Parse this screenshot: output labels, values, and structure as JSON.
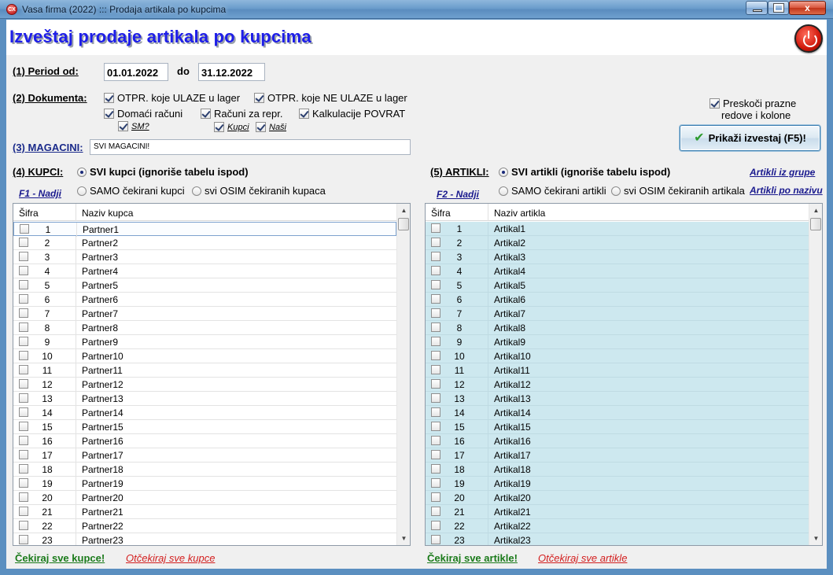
{
  "window": {
    "icon_text": "CX",
    "title": "Vasa firma (2022) ::: Prodaja artikala po kupcima",
    "minimize": "_",
    "maximize": "",
    "close": "x"
  },
  "header": {
    "title": "Izveštaj prodaje artikala po kupcima"
  },
  "period": {
    "label": "(1)  Period od:",
    "from": "01.01.2022",
    "to_label": "do",
    "to": "31.12.2022"
  },
  "documents": {
    "label": "(2)  Dokumenta:",
    "otpr_ulaze": "OTPR. koje ULAZE u lager",
    "otpr_ne_ulaze": "OTPR. koje NE ULAZE u lager",
    "domaci": "Domaći računi",
    "racuni_repr": "Računi za repr.",
    "kalkulacije": "Kalkulacije POVRAT",
    "sm": "SM?",
    "kupci": "Kupci",
    "nasi": "Naši"
  },
  "skip_empty": {
    "line1": "Preskoči prazne",
    "line2": "redove i kolone"
  },
  "show_button": {
    "icon": "✔",
    "label": "Prikaži izvestaj (F5)!"
  },
  "warehouses": {
    "label": "(3)  MAGACINI:",
    "value": "SVI MAGACINI!"
  },
  "customers": {
    "label": "(4)  KUPCI:",
    "all": "SVI kupci (ignoriše tabelu ispod)",
    "only_checked": "SAMO čekirani kupci",
    "except_checked": "svi OSIM čekiranih kupaca",
    "find_link": "F1 - Nadji",
    "col_code": "Šifra",
    "col_name": "Naziv kupca",
    "check_all": "Čekiraj sve kupce!",
    "uncheck_all": "Otčekiraj sve kupce",
    "rows": [
      {
        "code": "1",
        "name": "Partner1"
      },
      {
        "code": "2",
        "name": "Partner2"
      },
      {
        "code": "3",
        "name": "Partner3"
      },
      {
        "code": "4",
        "name": "Partner4"
      },
      {
        "code": "5",
        "name": "Partner5"
      },
      {
        "code": "6",
        "name": "Partner6"
      },
      {
        "code": "7",
        "name": "Partner7"
      },
      {
        "code": "8",
        "name": "Partner8"
      },
      {
        "code": "9",
        "name": "Partner9"
      },
      {
        "code": "10",
        "name": "Partner10"
      },
      {
        "code": "11",
        "name": "Partner11"
      },
      {
        "code": "12",
        "name": "Partner12"
      },
      {
        "code": "13",
        "name": "Partner13"
      },
      {
        "code": "14",
        "name": "Partner14"
      },
      {
        "code": "15",
        "name": "Partner15"
      },
      {
        "code": "16",
        "name": "Partner16"
      },
      {
        "code": "17",
        "name": "Partner17"
      },
      {
        "code": "18",
        "name": "Partner18"
      },
      {
        "code": "19",
        "name": "Partner19"
      },
      {
        "code": "20",
        "name": "Partner20"
      },
      {
        "code": "21",
        "name": "Partner21"
      },
      {
        "code": "22",
        "name": "Partner22"
      },
      {
        "code": "23",
        "name": "Partner23"
      }
    ]
  },
  "articles": {
    "label": "(5)  ARTIKLI:",
    "all": "SVI artikli (ignoriše tabelu ispod)",
    "only_checked": "SAMO čekirani artikli",
    "except_checked": "svi OSIM čekiranih artikala",
    "find_link": "F2 - Nadji",
    "group_link": "Artikli iz grupe",
    "name_link": "Artikli po nazivu",
    "col_code": "Šifra",
    "col_name": "Naziv artikla",
    "check_all": "Čekiraj sve artikle!",
    "uncheck_all": "Otčekiraj sve artikle",
    "rows": [
      {
        "code": "1",
        "name": "Artikal1"
      },
      {
        "code": "2",
        "name": "Artikal2"
      },
      {
        "code": "3",
        "name": "Artikal3"
      },
      {
        "code": "4",
        "name": "Artikal4"
      },
      {
        "code": "5",
        "name": "Artikal5"
      },
      {
        "code": "6",
        "name": "Artikal6"
      },
      {
        "code": "7",
        "name": "Artikal7"
      },
      {
        "code": "8",
        "name": "Artikal8"
      },
      {
        "code": "9",
        "name": "Artikal9"
      },
      {
        "code": "10",
        "name": "Artikal10"
      },
      {
        "code": "11",
        "name": "Artikal11"
      },
      {
        "code": "12",
        "name": "Artikal12"
      },
      {
        "code": "13",
        "name": "Artikal13"
      },
      {
        "code": "14",
        "name": "Artikal14"
      },
      {
        "code": "15",
        "name": "Artikal15"
      },
      {
        "code": "16",
        "name": "Artikal16"
      },
      {
        "code": "17",
        "name": "Artikal17"
      },
      {
        "code": "18",
        "name": "Artikal18"
      },
      {
        "code": "19",
        "name": "Artikal19"
      },
      {
        "code": "20",
        "name": "Artikal20"
      },
      {
        "code": "21",
        "name": "Artikal21"
      },
      {
        "code": "22",
        "name": "Artikal22"
      },
      {
        "code": "23",
        "name": "Artikal23"
      }
    ]
  },
  "colors": {
    "title_blue": "#1e1ee8",
    "article_row_bg": "#cde8ef",
    "link_green": "#1a7a1a",
    "link_red": "#d31e1e"
  }
}
